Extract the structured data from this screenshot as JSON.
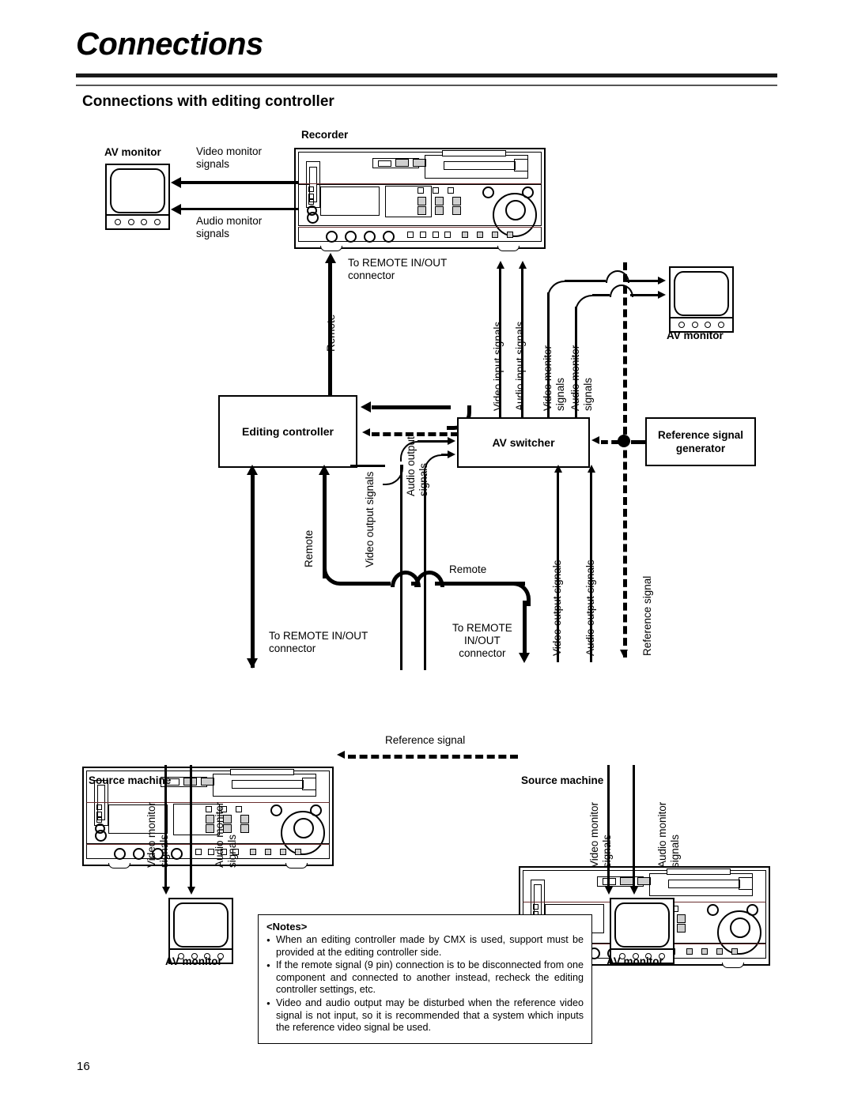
{
  "header": {
    "title": "Connections",
    "section_title": "Connections with editing controller"
  },
  "page_number": "16",
  "devices": {
    "recorder": "Recorder",
    "editing_controller": "Editing controller",
    "av_switcher": "AV switcher",
    "reference_signal_generator": "Reference signal\ngenerator",
    "source_machine_left": "Source machine",
    "source_machine_right": "Source machine",
    "av_monitor_top_left": "AV monitor",
    "av_monitor_top_right": "AV monitor",
    "av_monitor_bottom_left": "AV monitor",
    "av_monitor_bottom_right": "AV monitor"
  },
  "labels": {
    "video_monitor_signals_tl": "Video monitor\nsignals",
    "audio_monitor_signals_tl": "Audio monitor\nsignals",
    "to_remote_in_out_top": "To REMOTE IN/OUT\nconnector",
    "remote_top": "Remote",
    "video_input_signals": "Video input signals",
    "audio_input_signals": "Audio input signals",
    "video_monitor_signals_right": "Video monitor\nsignals",
    "audio_monitor_signals_right": "Audio monitor\nsignals",
    "remote_left": "Remote",
    "video_output_signals_left": "Video output signals",
    "audio_output_signals_left": "Audio output\nsignals",
    "remote_mid": "Remote",
    "to_remote_in_out_left": "To REMOTE IN/OUT\nconnector",
    "to_remote_in_out_mid": "To REMOTE\nIN/OUT\nconnector",
    "video_output_signals_right": "Video output signals",
    "audio_output_signals_right": "Audio output signals",
    "reference_signal_vertical": "Reference signal",
    "reference_signal_horizontal": "Reference signal",
    "video_monitor_signals_bl": "Video monitor\nsignals",
    "audio_monitor_signals_bl": "Audio monitor\nsignals",
    "video_monitor_signals_br": "Video monitor\nsignals",
    "audio_monitor_signals_br": "Audio monitor\nsignals"
  },
  "notes": {
    "heading": "<Notes>",
    "items": [
      "When an editing controller made by CMX is used, support must be provided at the editing controller side.",
      "If the remote signal (9 pin) connection is to be disconnected from one component and connected to another instead, recheck the editing controller settings, etc.",
      "Video and audio output may be disturbed when the reference video signal is not input, so it is recommended that a system which inputs the reference video signal be used."
    ]
  }
}
